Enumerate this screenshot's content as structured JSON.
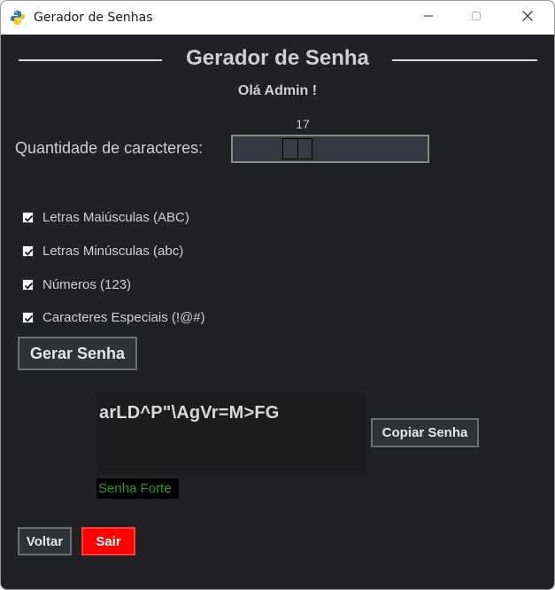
{
  "window": {
    "title": "Gerador de Senhas",
    "controls": {
      "minimize_icon": "minimize-icon",
      "maximize_icon": "maximize-icon",
      "close_icon": "close-icon"
    }
  },
  "header": {
    "title": "Gerador de Senha",
    "greeting": "Olá Admin !"
  },
  "length": {
    "label": "Quantidade de caracteres:",
    "value": "17",
    "fraction": 0.3
  },
  "options": [
    {
      "label": "Letras Maiúsculas (ABC)",
      "checked": true
    },
    {
      "label": "Letras Minúsculas (abc)",
      "checked": true
    },
    {
      "label": "Números (123)",
      "checked": true
    },
    {
      "label": "Caracteres Especiais (!@#)",
      "checked": true
    }
  ],
  "actions": {
    "generate": "Gerar Senha",
    "copy": "Copiar Senha",
    "back": "Voltar",
    "exit": "Sair"
  },
  "result": {
    "password": "arLD^P\"\\AgVr=M>FG",
    "strength": "Senha Forte"
  },
  "colors": {
    "background": "#202124",
    "exit_button": "#ff0000",
    "strength_text": "#1f9d2a"
  }
}
